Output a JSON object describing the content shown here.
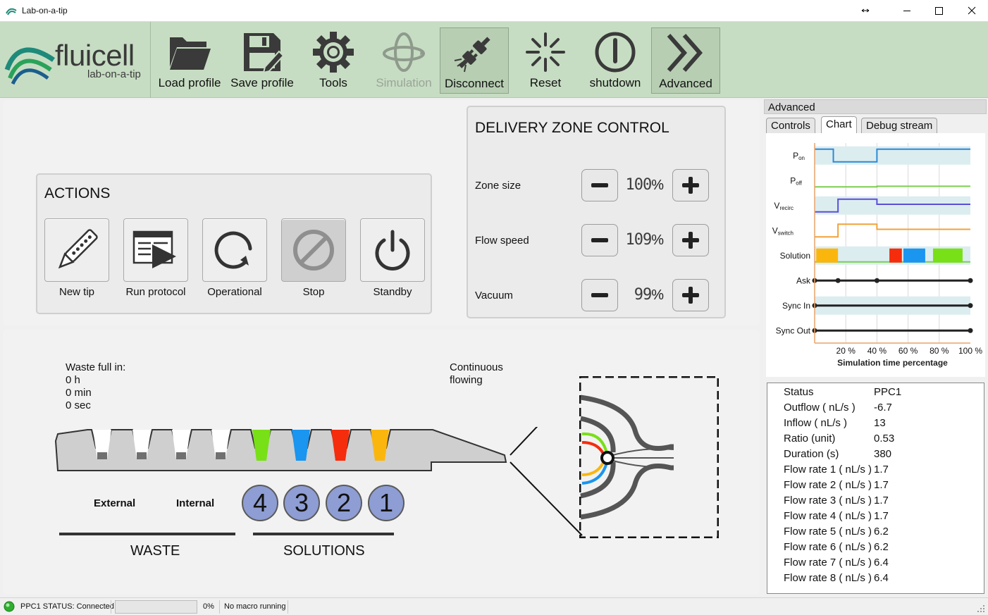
{
  "window": {
    "title": "Lab-on-a-tip"
  },
  "logo": {
    "brand": "fluicell",
    "tagline": "lab-on-a-tip"
  },
  "toolbar": {
    "load_profile": "Load profile",
    "save_profile": "Save profile",
    "tools": "Tools",
    "simulation": "Simulation",
    "disconnect": "Disconnect",
    "reset": "Reset",
    "shutdown": "shutdown",
    "advanced": "Advanced"
  },
  "actions": {
    "title": "ACTIONS",
    "new_tip": "New tip",
    "run_protocol": "Run protocol",
    "operational": "Operational",
    "stop": "Stop",
    "standby": "Standby"
  },
  "delivery_zone": {
    "title": "DELIVERY ZONE CONTROL",
    "zone_size_label": "Zone size",
    "zone_size_value": "100",
    "flow_speed_label": "Flow speed",
    "flow_speed_value": "109",
    "vacuum_label": "Vacuum",
    "vacuum_value": "99",
    "unit": "%"
  },
  "tip": {
    "waste_title": "Waste full in:",
    "waste_h": "0 h",
    "waste_min": "0 min",
    "waste_sec": "0 sec",
    "flow_line1": "Continuous",
    "flow_line2": "flowing",
    "external": "External",
    "internal": "Internal",
    "waste": "WASTE",
    "solutions": "SOLUTIONS",
    "wells": [
      "4",
      "3",
      "2",
      "1"
    ],
    "well_colors": [
      "#78e016",
      "#1a95f0",
      "#f52d0d",
      "#fbb60e"
    ]
  },
  "dock": {
    "title": "Advanced",
    "tabs": [
      "Controls",
      "Chart",
      "Debug stream"
    ],
    "active_tab": "Chart"
  },
  "chart_data": {
    "type": "line",
    "xlabel": "Simulation time percentage",
    "x_ticks": [
      "20 %",
      "40 %",
      "60 %",
      "80 %",
      "100 %"
    ],
    "xlim": [
      0,
      100
    ],
    "rows": [
      {
        "label": "P",
        "sub": "on",
        "color": "#2b8ad6",
        "points": [
          [
            0,
            1
          ],
          [
            12,
            1
          ],
          [
            12,
            0
          ],
          [
            40,
            0
          ],
          [
            40,
            1
          ],
          [
            100,
            1
          ]
        ]
      },
      {
        "label": "P",
        "sub": "off",
        "color": "#7bcf4f",
        "points": [
          [
            0,
            0
          ],
          [
            40,
            0
          ],
          [
            40,
            0.05
          ],
          [
            100,
            0.05
          ]
        ]
      },
      {
        "label": "V",
        "sub": "recirc",
        "color": "#5a4fd8",
        "points": [
          [
            0,
            0
          ],
          [
            15,
            0
          ],
          [
            15,
            1
          ],
          [
            40,
            1
          ],
          [
            40,
            0.6
          ],
          [
            100,
            0.6
          ]
        ]
      },
      {
        "label": "V",
        "sub": "switch",
        "color": "#f0a33a",
        "points": [
          [
            0,
            0
          ],
          [
            15,
            0
          ],
          [
            15,
            1
          ],
          [
            40,
            1
          ],
          [
            40,
            0.6
          ],
          [
            100,
            0.6
          ]
        ]
      },
      {
        "label": "Solution",
        "sub": "",
        "color": "#7bcf4f",
        "blocks": [
          {
            "from": 1,
            "to": 15,
            "color": "#fbb60e"
          },
          {
            "from": 48,
            "to": 56,
            "color": "#f52d0d"
          },
          {
            "from": 57,
            "to": 71,
            "color": "#1a95f0"
          },
          {
            "from": 76,
            "to": 95,
            "color": "#78e016"
          }
        ]
      },
      {
        "label": "Ask",
        "sub": "",
        "color": "#222222",
        "markers": [
          0,
          15,
          40,
          100
        ]
      },
      {
        "label": "Sync In",
        "sub": "",
        "color": "#222222",
        "markers": [
          0,
          100
        ]
      },
      {
        "label": "Sync Out",
        "sub": "",
        "color": "#222222",
        "markers": [
          0,
          100
        ]
      }
    ]
  },
  "status_table": [
    {
      "label": "Status",
      "value": "PPC1"
    },
    {
      "label": "Outflow ( nL/s )",
      "value": "-6.7"
    },
    {
      "label": "Inflow ( nL/s )",
      "value": "13"
    },
    {
      "label": "Ratio (unit)",
      "value": "0.53"
    },
    {
      "label": "Duration (s)",
      "value": "380"
    },
    {
      "label": "Flow rate 1 ( nL/s )",
      "value": "1.7"
    },
    {
      "label": "Flow rate 2 ( nL/s )",
      "value": "1.7"
    },
    {
      "label": "Flow rate 3 ( nL/s )",
      "value": "1.7"
    },
    {
      "label": "Flow rate 4 ( nL/s )",
      "value": "1.7"
    },
    {
      "label": "Flow rate 5 ( nL/s )",
      "value": "6.2"
    },
    {
      "label": "Flow rate 6 ( nL/s )",
      "value": "6.2"
    },
    {
      "label": "Flow rate 7 ( nL/s )",
      "value": "6.4"
    },
    {
      "label": "Flow rate 8 ( nL/s )",
      "value": "6.4"
    }
  ],
  "statusbar": {
    "connection": "PPC1 STATUS: Connected",
    "progress_percent": "0%",
    "progress": 0,
    "macro": "No macro running"
  }
}
